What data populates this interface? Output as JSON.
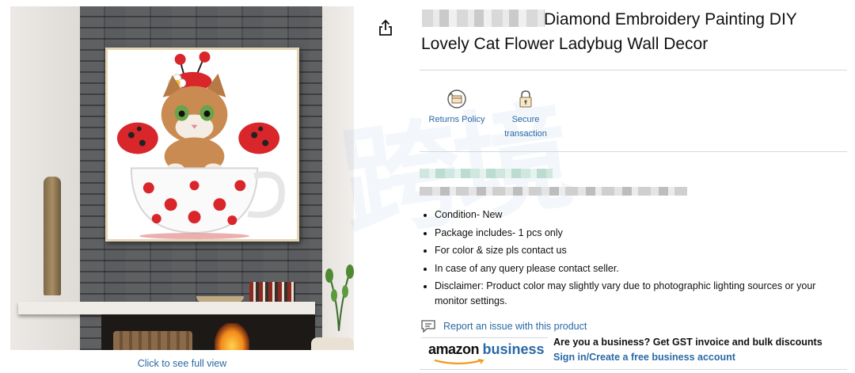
{
  "image_panel": {
    "full_view_link": "Click to see full view"
  },
  "product": {
    "title": "Diamond Embroidery Painting DIY Lovely Cat Flower Ladybug Wall Decor"
  },
  "trust_badges": [
    {
      "label": "Returns Policy",
      "icon": "returns-box-icon"
    },
    {
      "label": "Secure transaction",
      "icon": "lock-icon"
    }
  ],
  "watermark": "跨境",
  "bullets": [
    "Condition- New",
    "Package includes- 1 pcs only",
    "For color & size pls contact us",
    "In case of any query please contact seller.",
    "Disclaimer: Product color may slightly vary due to photographic lighting sources or your monitor settings."
  ],
  "report": {
    "label": "Report an issue with this product",
    "icon": "message-flag-icon"
  },
  "amazon_business": {
    "logo_amazon": "amazon",
    "logo_business": "business",
    "headline": "Are you a business? Get GST invoice and bulk discounts",
    "link": "Sign in/Create a free business account"
  },
  "colors": {
    "link": "#2a69a5",
    "text": "#0f1111",
    "divider": "#d5d9d9",
    "ladybug_red": "#d9262b"
  }
}
